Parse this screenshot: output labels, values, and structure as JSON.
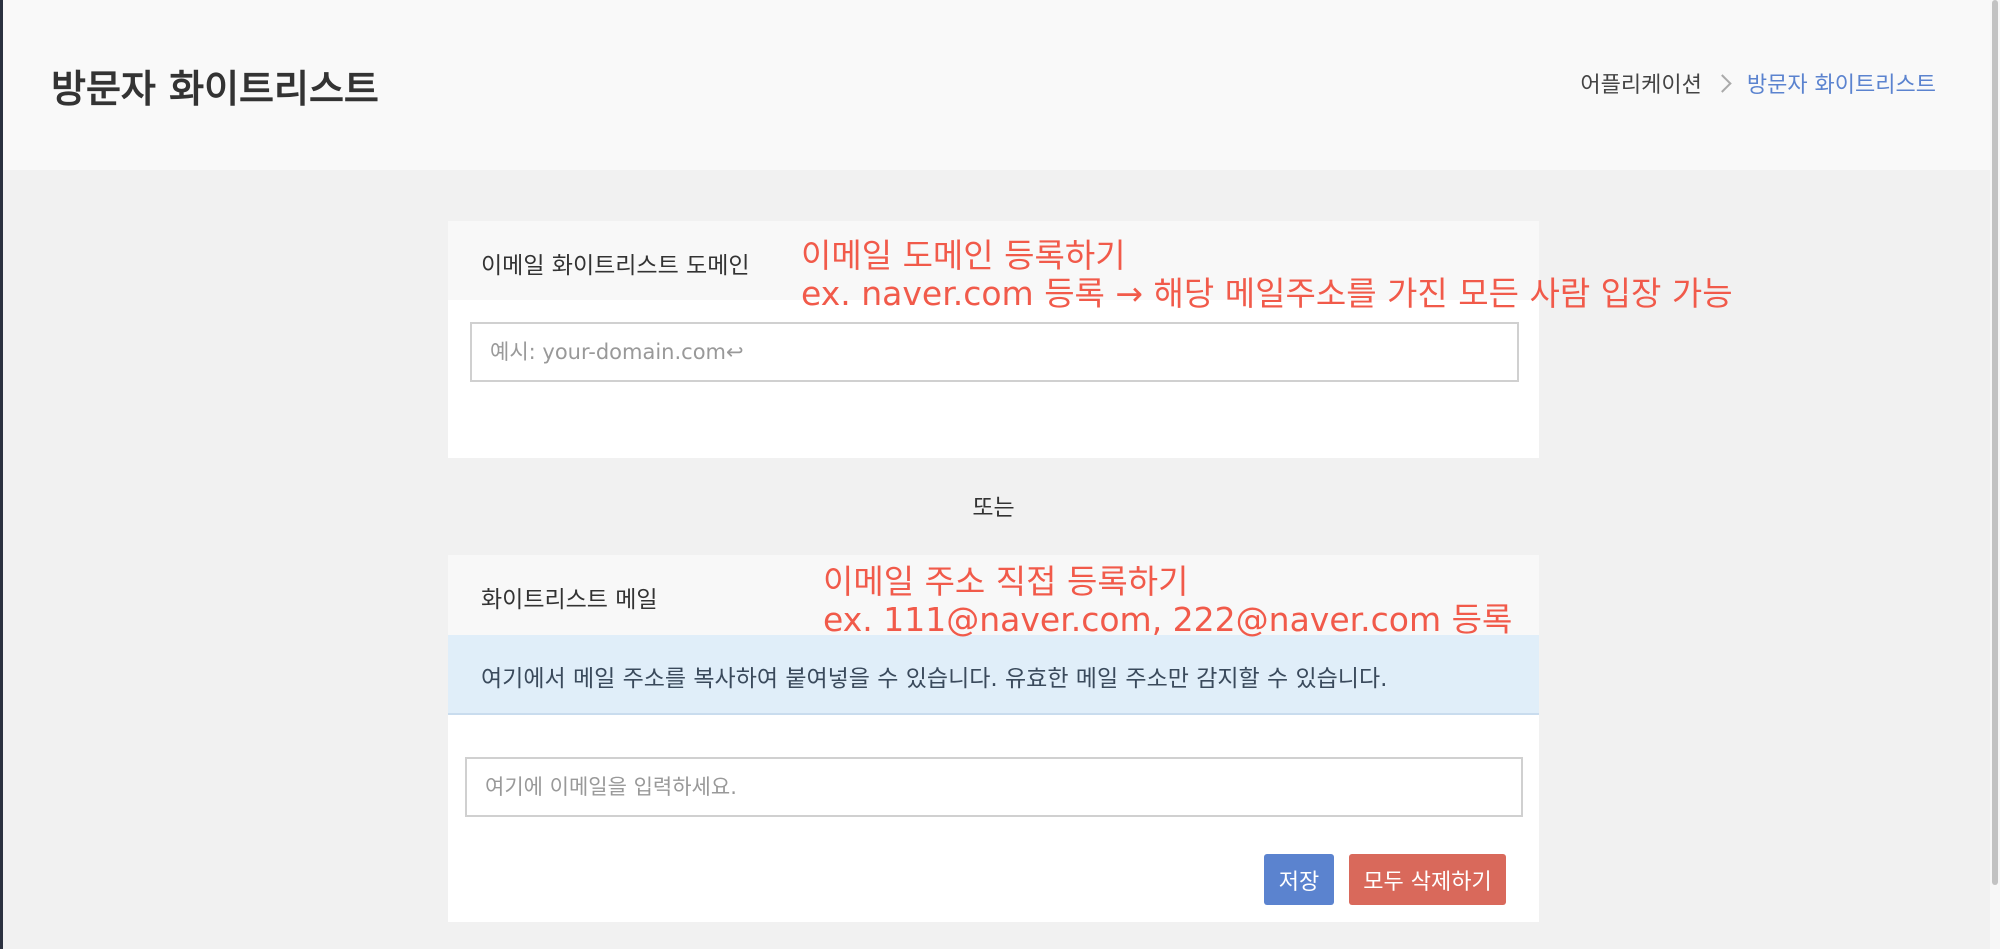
{
  "header": {
    "title": "방문자 화이트리스트",
    "breadcrumb": {
      "parent": "어플리케이션",
      "current": "방문자 화이트리스트"
    }
  },
  "domain_section": {
    "title": "이메일 화이트리스트 도메인",
    "input_placeholder": "예시: your-domain.com↩",
    "input_value": ""
  },
  "divider_text": "또는",
  "email_section": {
    "title": "화이트리스트 메일",
    "info_text": "여기에서 메일 주소를 복사하여 붙여넣을 수 있습니다. 유효한 메일 주소만 감지할 수 있습니다.",
    "input_placeholder": "여기에 이메일을 입력하세요.",
    "input_value": "",
    "save_label": "저장",
    "delete_all_label": "모두 삭제하기"
  },
  "annotations": {
    "domain": {
      "line1": "이메일 도메인 등록하기",
      "line2": "ex. naver.com 등록 → 해당 메일주소를 가진 모든 사람 입장 가능"
    },
    "email": {
      "line1": "이메일 주소 직접 등록하기",
      "line2": "ex. 111@naver.com, 222@naver.com 등록"
    }
  },
  "colors": {
    "accent": "#5b83cf",
    "danger": "#d9695b",
    "annotation": "#f15a4a",
    "info_background": "#e0eef9"
  }
}
